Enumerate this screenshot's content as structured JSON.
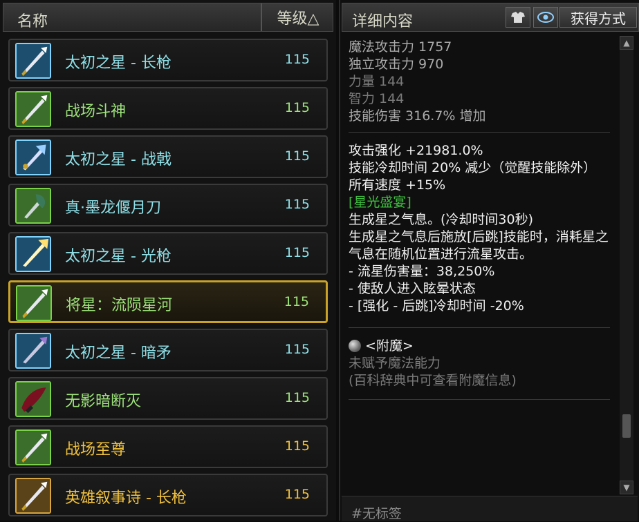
{
  "list_header": {
    "name": "名称",
    "level": "等级△"
  },
  "items": [
    {
      "name": "太初之星 - 长枪",
      "level": "115",
      "color": "#8fe0e8",
      "tier": "blue",
      "icon": "spear-icon"
    },
    {
      "name": "战场斗神",
      "level": "115",
      "color": "#9de37a",
      "tier": "green",
      "icon": "spear-icon"
    },
    {
      "name": "太初之星 - 战戟",
      "level": "115",
      "color": "#8fe0e8",
      "tier": "blue",
      "icon": "halberd-icon"
    },
    {
      "name": "真·墨龙偃月刀",
      "level": "115",
      "color": "#8fe0e8",
      "tier": "green",
      "icon": "glaive-icon"
    },
    {
      "name": "太初之星 - 光枪",
      "level": "115",
      "color": "#8fe0e8",
      "tier": "blue",
      "icon": "lightspear-icon"
    },
    {
      "name": "将星：流陨星河",
      "level": "115",
      "color": "#9de37a",
      "tier": "green",
      "icon": "spear-icon",
      "selected": true
    },
    {
      "name": "太初之星 - 暗矛",
      "level": "115",
      "color": "#8fe0e8",
      "tier": "blue",
      "icon": "darkspear-icon"
    },
    {
      "name": "无影暗断灭",
      "level": "115",
      "color": "#9de37a",
      "tier": "green",
      "icon": "dark-blade-icon"
    },
    {
      "name": "战场至尊",
      "level": "115",
      "color": "#f2c23d",
      "tier": "green",
      "icon": "spear-icon"
    },
    {
      "name": "英雄叙事诗 - 长枪",
      "level": "115",
      "color": "#f2c23d",
      "tier": "gold",
      "icon": "spear-icon"
    }
  ],
  "detail_header": {
    "title": "详细内容",
    "acquire_label": "获得方式",
    "wardrobe_icon": "wardrobe-icon",
    "eye_icon": "eye-icon"
  },
  "detail": {
    "stats": [
      {
        "text": "魔法攻击力 1757"
      },
      {
        "text": "独立攻击力 970"
      },
      {
        "text": "力量 144"
      },
      {
        "text": "智力 144"
      },
      {
        "text": "技能伤害 316.7% 增加"
      }
    ],
    "options": [
      "攻击强化 +21981.0%",
      "技能冷却时间 20% 减少（觉醒技能除外）",
      "所有速度 +15%"
    ],
    "set_name": "[星光盛宴]",
    "set_effects": [
      "生成星之气息。(冷却时间30秒)",
      "生成星之气息后施放[后跳]技能时，消耗星之气息在随机位置进行流星攻击。",
      "- 流星伤害量：38,250%",
      "- 使敌人进入眩晕状态",
      "- [强化 - 后跳]冷却时间 -20%"
    ],
    "enchant_title": "<附魔>",
    "enchant_lines": [
      "未赋予魔法能力",
      "(百科辞典中可查看附魔信息)"
    ],
    "tag": "#无标签"
  },
  "colors": {
    "accent_gold": "#c9a227",
    "set_green": "#3fbf3f"
  }
}
